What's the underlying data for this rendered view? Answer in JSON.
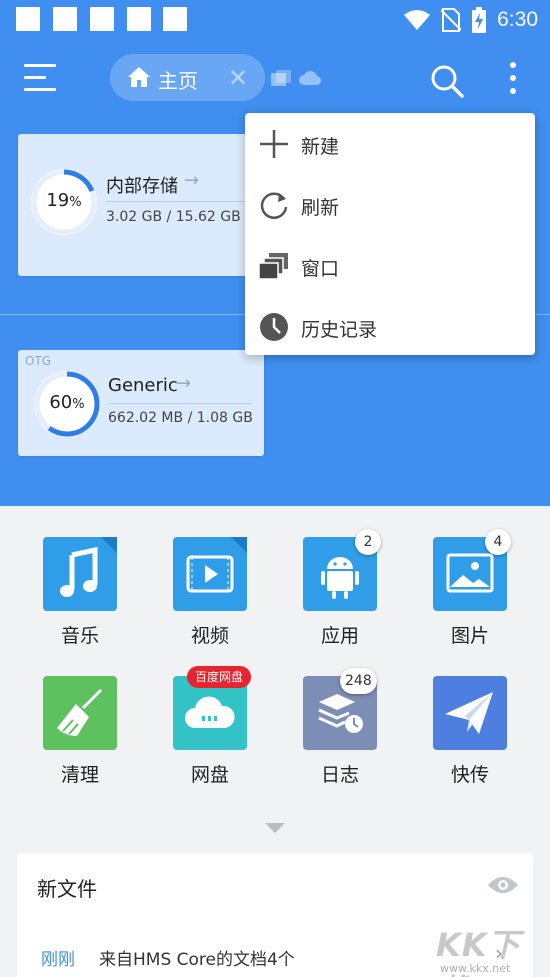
{
  "status_bar": {
    "time": "6:30"
  },
  "app_bar": {
    "home_tab_label": "主页"
  },
  "storage": [
    {
      "percent": "19",
      "percent_unit": "%",
      "percent_value": 19,
      "name": "内部存储",
      "size": "3.02 GB / 15.62 GB"
    },
    {
      "tag": "OTG",
      "percent": "60",
      "percent_unit": "%",
      "percent_value": 60,
      "name": "Generic",
      "size": "662.02 MB / 1.08 GB"
    }
  ],
  "popup_menu": [
    {
      "label": "新建",
      "icon": "plus-icon"
    },
    {
      "label": "刷新",
      "icon": "refresh-icon"
    },
    {
      "label": "窗口",
      "icon": "windows-icon"
    },
    {
      "label": "历史记录",
      "icon": "clock-icon"
    }
  ],
  "categories": [
    {
      "label": "音乐",
      "icon": "music-icon",
      "color": "#2f9de8"
    },
    {
      "label": "视频",
      "icon": "video-icon",
      "color": "#2f9de8"
    },
    {
      "label": "应用",
      "icon": "android-icon",
      "color": "#2f9de8",
      "badge": "2"
    },
    {
      "label": "图片",
      "icon": "image-icon",
      "color": "#2f9de8",
      "badge": "4"
    },
    {
      "label": "清理",
      "icon": "broom-icon",
      "color": "#5cc15e"
    },
    {
      "label": "网盘",
      "icon": "cloud-disk-icon",
      "color": "#33c2c6",
      "promo": "百度网盘"
    },
    {
      "label": "日志",
      "icon": "log-icon",
      "color": "#7c8db6",
      "badge": "248"
    },
    {
      "label": "快传",
      "icon": "send-icon",
      "color": "#4d7fe0"
    }
  ],
  "new_files": {
    "title": "新文件",
    "when": "刚刚",
    "description": "来自HMS Core的文档4个"
  },
  "watermark": {
    "big": "KK下载",
    "small": "www.kkx.net"
  },
  "colors": {
    "accent": "#3f8ef0",
    "ring": "#2f7de6",
    "badge_red": "#e8242f"
  }
}
